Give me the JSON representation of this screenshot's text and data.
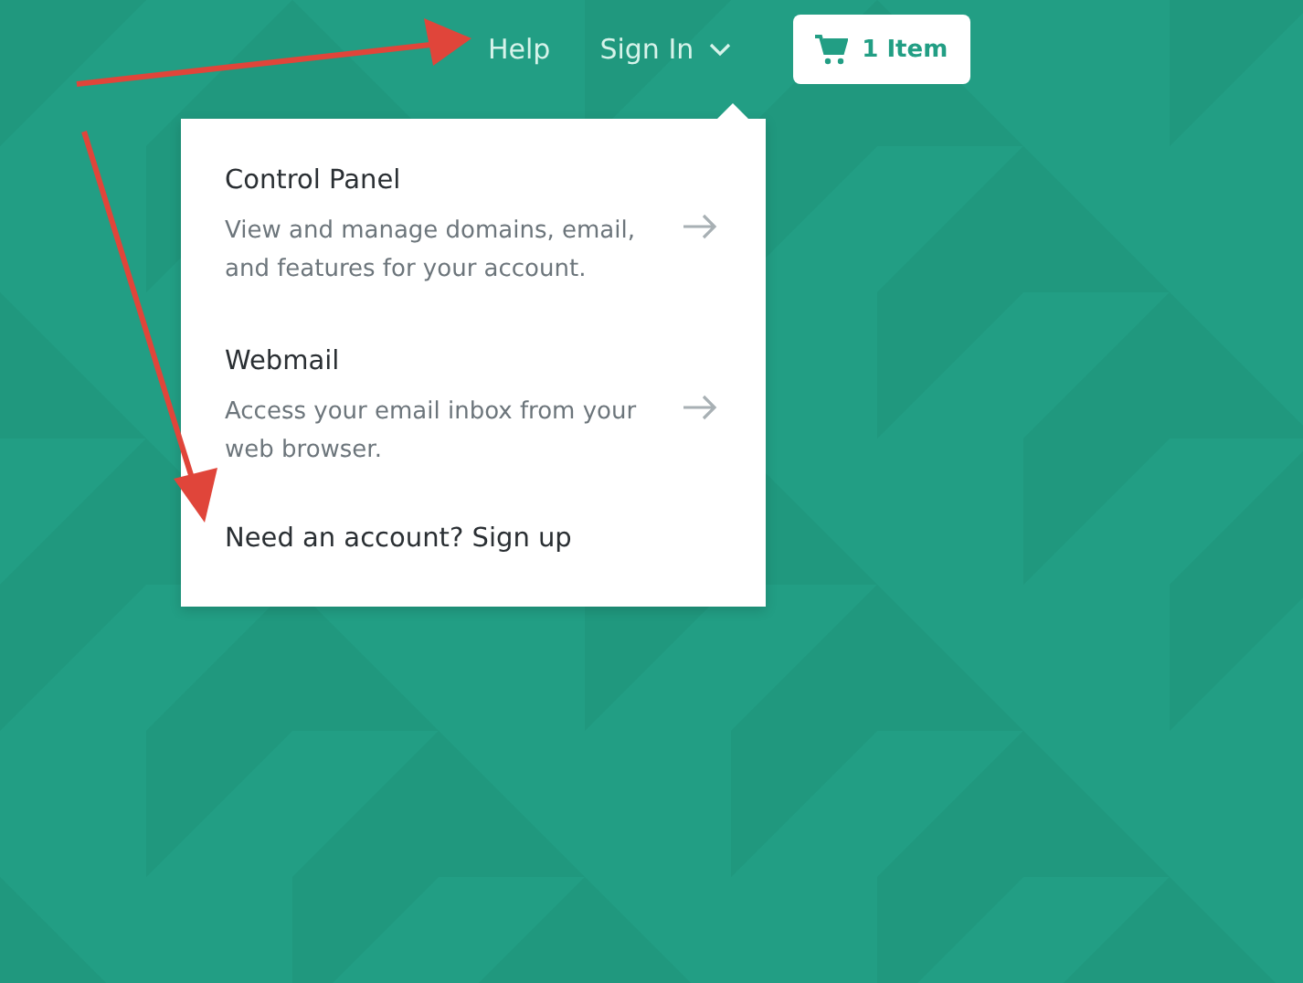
{
  "nav": {
    "help": "Help",
    "sign_in": {
      "label": "Sign In",
      "expanded": true
    },
    "cart": {
      "label": "1 Item"
    }
  },
  "menu": {
    "items": [
      {
        "title": "Control Panel",
        "description": "View and manage domains, email, and features for your account."
      },
      {
        "title": "Webmail",
        "description": "Access your email inbox from your web browser."
      }
    ],
    "signup": "Need an account? Sign up"
  }
}
